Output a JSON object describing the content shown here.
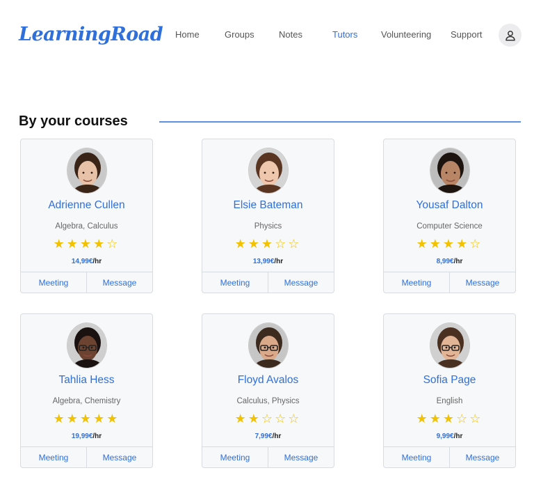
{
  "header": {
    "logo": "LearningRoad",
    "nav": [
      {
        "label": "Home",
        "active": false
      },
      {
        "label": "Groups",
        "active": false
      },
      {
        "label": "Notes",
        "active": false
      },
      {
        "label": "Tutors",
        "active": true
      },
      {
        "label": "Volunteering",
        "active": false
      },
      {
        "label": "Support",
        "active": false
      }
    ],
    "profile_icon": "user-icon"
  },
  "section": {
    "title": "By your courses"
  },
  "tutors": [
    {
      "name": "Adrienne Cullen",
      "subjects": "Algebra, Calculus",
      "rating": 4,
      "max_rating": 5,
      "price": "14,99€",
      "unit": "/hr",
      "meeting_label": "Meeting",
      "message_label": "Message"
    },
    {
      "name": "Elsie Bateman",
      "subjects": "Physics",
      "rating": 3,
      "max_rating": 5,
      "price": "13,99€",
      "unit": "/hr",
      "meeting_label": "Meeting",
      "message_label": "Message"
    },
    {
      "name": "Yousaf Dalton",
      "subjects": "Computer Science",
      "rating": 4,
      "max_rating": 5,
      "price": "8,99€",
      "unit": "/hr",
      "meeting_label": "Meeting",
      "message_label": "Message"
    },
    {
      "name": "Tahlia Hess",
      "subjects": "Algebra, Chemistry",
      "rating": 5,
      "max_rating": 5,
      "price": "19,99€",
      "unit": "/hr",
      "meeting_label": "Meeting",
      "message_label": "Message"
    },
    {
      "name": "Floyd Avalos",
      "subjects": "Calculus, Physics",
      "rating": 2,
      "max_rating": 5,
      "price": "7,99€",
      "unit": "/hr",
      "meeting_label": "Meeting",
      "message_label": "Message"
    },
    {
      "name": "Sofia Page",
      "subjects": "English",
      "rating": 3,
      "max_rating": 5,
      "price": "9,99€",
      "unit": "/hr",
      "meeting_label": "Meeting",
      "message_label": "Message"
    }
  ],
  "colors": {
    "accent": "#2f6fdb",
    "star": "#f2c200",
    "card_bg": "#f7f8fa",
    "border": "#d8dbe0"
  }
}
